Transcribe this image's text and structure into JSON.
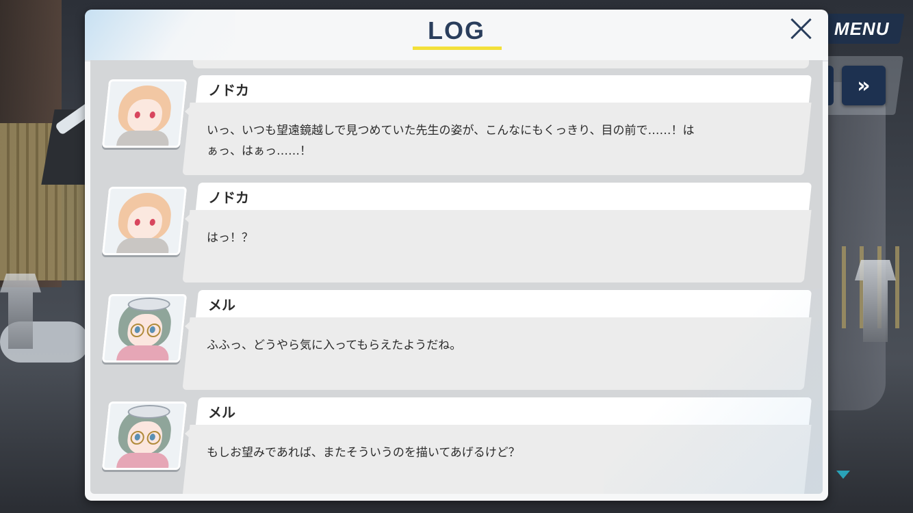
{
  "hud": {
    "menu_label": "MENU",
    "fast_forward_symbol": "»"
  },
  "log": {
    "title": "LOG",
    "close_symbol": "×",
    "entries": [
      {
        "speaker": "ノドカ",
        "avatar": "nodoka-portrait",
        "message": "いっ、いつも望遠鏡越しで見つめていた先生の姿が、こんなにもくっきり、目の前で……！は\nぁっ、はぁっ……！"
      },
      {
        "speaker": "ノドカ",
        "avatar": "nodoka-portrait",
        "message": "はっ！？"
      },
      {
        "speaker": "メル",
        "avatar": "meru-portrait",
        "message": "ふふっ、どうやら気に入ってもらえたようだね。"
      },
      {
        "speaker": "メル",
        "avatar": "meru-portrait",
        "message": "もしお望みであれば、またそういうのを描いてあげるけど？"
      }
    ]
  },
  "colors": {
    "title": "#2a3e5c",
    "underline": "#f3e03a",
    "scroll_arrow": "#2aa3b8"
  }
}
